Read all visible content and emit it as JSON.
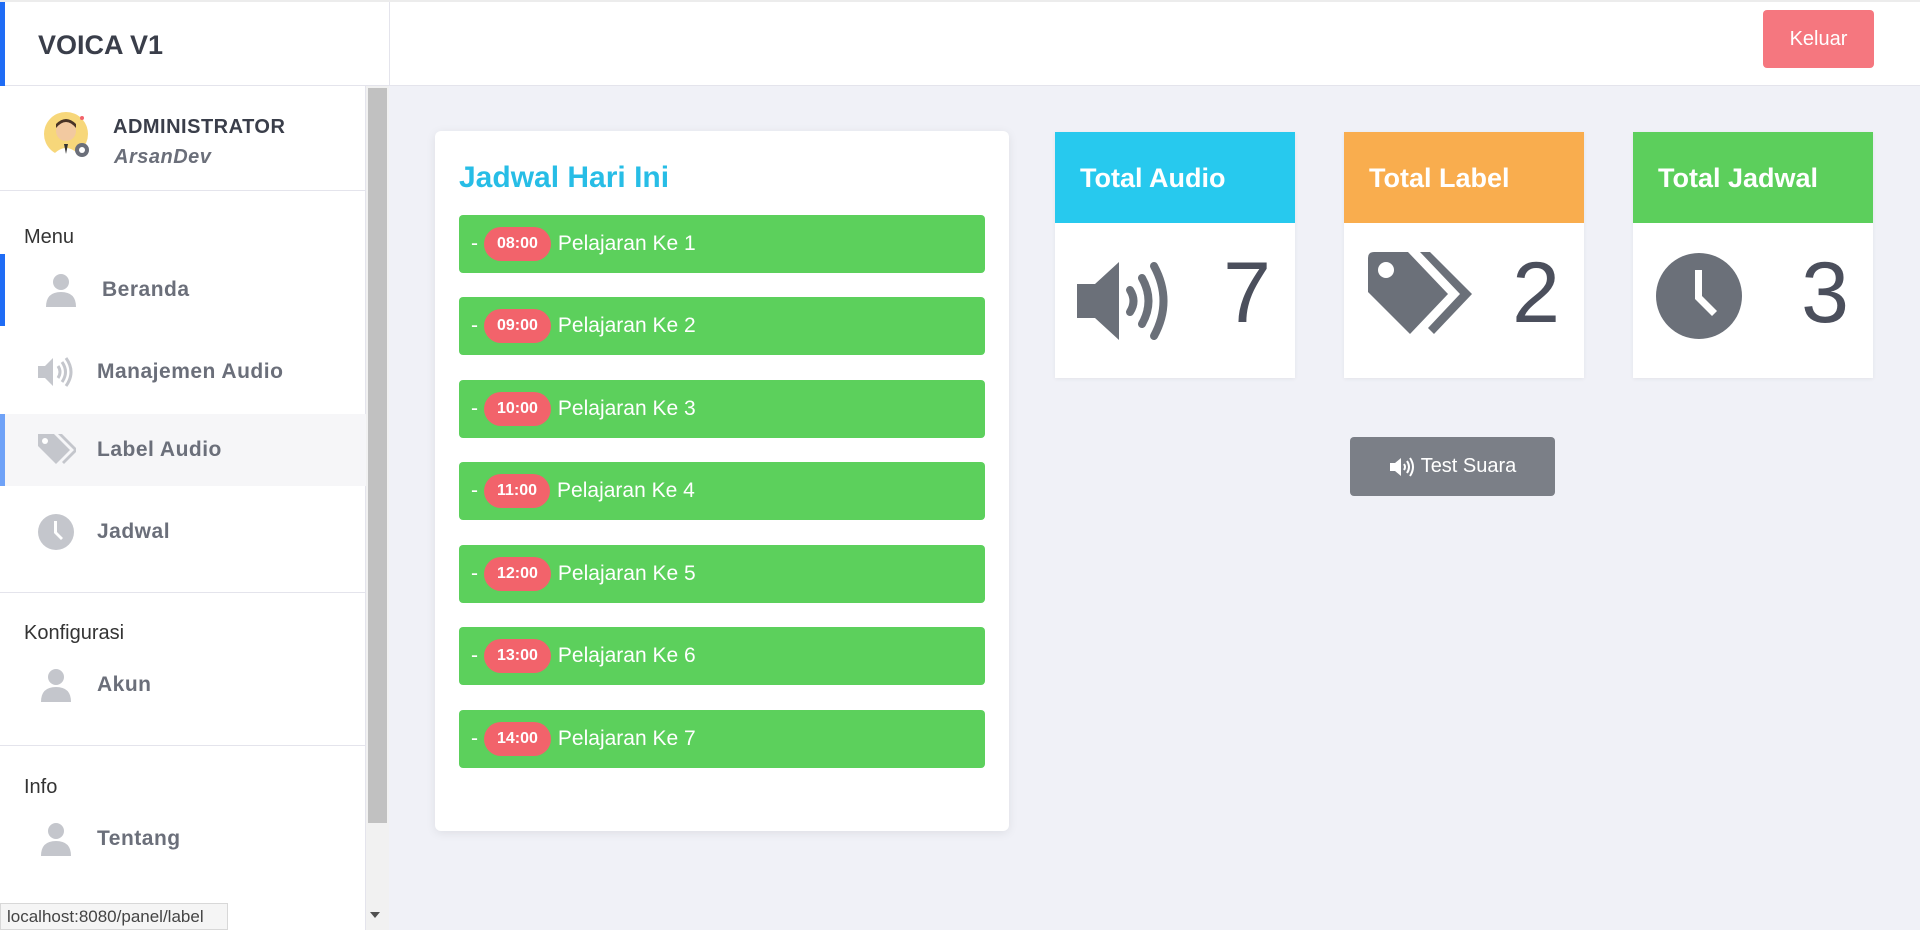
{
  "app": {
    "title": "VOICA V1",
    "logout_label": "Keluar"
  },
  "profile": {
    "role": "ADMINISTRATOR",
    "username": "ArsanDev"
  },
  "sidebar": {
    "menu_title": "Menu",
    "menu_items": [
      {
        "label": "Beranda",
        "icon": "user-icon"
      },
      {
        "label": "Manajemen Audio",
        "icon": "volume-icon"
      },
      {
        "label": "Label Audio",
        "icon": "tags-icon"
      },
      {
        "label": "Jadwal",
        "icon": "clock-icon"
      }
    ],
    "config_title": "Konfigurasi",
    "config_items": [
      {
        "label": "Akun",
        "icon": "user-icon"
      }
    ],
    "info_title": "Info",
    "info_items": [
      {
        "label": "Tentang",
        "icon": "user-icon"
      }
    ]
  },
  "schedule": {
    "title": "Jadwal Hari Ini",
    "dash": "-",
    "items": [
      {
        "time": "08:00",
        "label": "Pelajaran Ke 1"
      },
      {
        "time": "09:00",
        "label": "Pelajaran Ke 2"
      },
      {
        "time": "10:00",
        "label": "Pelajaran Ke 3"
      },
      {
        "time": "11:00",
        "label": "Pelajaran Ke 4"
      },
      {
        "time": "12:00",
        "label": "Pelajaran Ke 5"
      },
      {
        "time": "13:00",
        "label": "Pelajaran Ke 6"
      },
      {
        "time": "14:00",
        "label": "Pelajaran Ke 7"
      }
    ]
  },
  "stats": [
    {
      "title": "Total Audio",
      "value": "7",
      "color": "#27c9ee",
      "icon": "volume-icon"
    },
    {
      "title": "Total Label",
      "value": "2",
      "color": "#f9ad4e",
      "icon": "tags-icon"
    },
    {
      "title": "Total Jadwal",
      "value": "3",
      "color": "#5ccf5c",
      "icon": "clock-icon"
    }
  ],
  "test_button": {
    "label": "Test Suara",
    "icon": "volume-icon"
  },
  "status_url": "localhost:8080/panel/label",
  "colors": {
    "accent": "#1f6cf5",
    "schedule_bg": "#5cd05c",
    "time_badge": "#f2636b",
    "logout": "#f5777f"
  }
}
